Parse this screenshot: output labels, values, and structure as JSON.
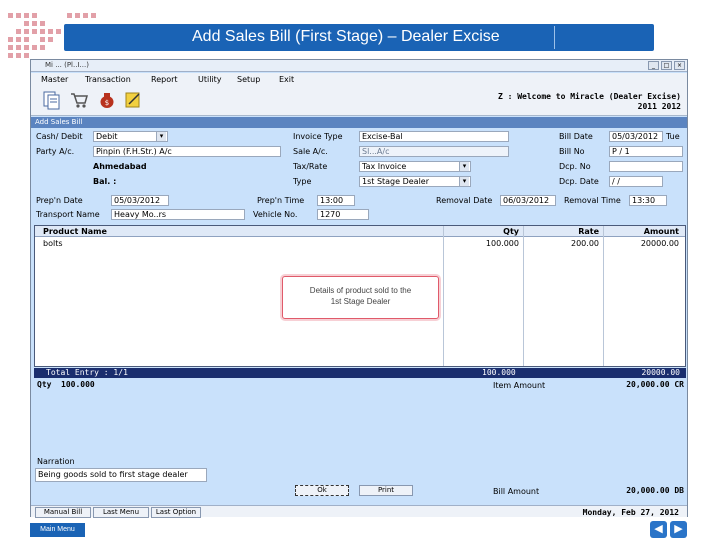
{
  "slide": {
    "title": "Add Sales Bill (First Stage) – Dealer Excise",
    "main_menu_label": "Main Menu",
    "prev_icon": "left-arrow-icon",
    "next_icon": "right-arrow-icon",
    "accent": "#1a63b5"
  },
  "window": {
    "title": "Mi ... (Pl..I...)",
    "menu": [
      "Master",
      "Transaction",
      "Report",
      "Utility",
      "Setup",
      "Exit"
    ],
    "welcome": "Z : Welcome to Miracle (Dealer Excise)",
    "year": "2011 2012",
    "subform_title": "Add Sales Bill"
  },
  "form": {
    "cash_debit_label": "Cash/ Debit",
    "cash_debit_value": "Debit",
    "party_label": "Party A/c.",
    "party_value": "Pinpin (F.H.Str.) A/c",
    "city": "Ahmedabad",
    "bal_label": "Bal. :",
    "invoice_type_label": "Invoice Type",
    "invoice_type_value": "Excise-Bal",
    "sale_ac_label": "Sale A/c.",
    "sale_ac_value": "Sl...A/c",
    "tax_rate_label": "Tax/Rate",
    "tax_rate_value": "Tax Invoice",
    "type_label": "Type",
    "type_value": "1st Stage Dealer",
    "bill_date_label": "Bill Date",
    "bill_date_value": "05/03/2012",
    "bill_date_suffix": "Tue",
    "bill_no_label": "Bill No",
    "bill_no_value": "P / 1",
    "dcp_no_label": "Dcp. No",
    "dcp_no_value": "",
    "dcp_date_label": "Dcp. Date",
    "dcp_date_value": "/ /",
    "prep_date_label": "Prep'n Date",
    "prep_date_value": "05/03/2012",
    "prep_time_label": "Prep'n Time",
    "prep_time_value": "13:00",
    "removal_date_label": "Removal Date",
    "removal_date_value": "06/03/2012",
    "removal_time_label": "Removal Time",
    "removal_time_value": "13:30",
    "transport_label": "Transport Name",
    "transport_value": "Heavy Mo..rs",
    "vehicle_label": "Vehicle No.",
    "vehicle_value": "1270"
  },
  "grid": {
    "headers": {
      "product": "Product Name",
      "qty": "Qty",
      "rate": "Rate",
      "amount": "Amount"
    },
    "rows": [
      {
        "product": "bolts",
        "qty": "100.000",
        "rate": "200.00",
        "amount": "20000.00"
      }
    ],
    "callout_line1": "Details of product sold to the",
    "callout_line2": "1st Stage Dealer",
    "total_entry": "Total Entry : 1/1",
    "total_qty": "100.000",
    "total_amount": "20000.00"
  },
  "summary": {
    "qty_label": "Qty",
    "qty_value": "100.000",
    "item_amount_label": "Item Amount",
    "item_amount_value": "20,000.00 CR",
    "narration_label": "Narration",
    "narration_value": "Being goods sold to first stage dealer",
    "ok_label": "Ok",
    "print_label": "Print",
    "bill_amount_label": "Bill Amount",
    "bill_amount_value": "20,000.00 DB"
  },
  "status": {
    "buttons": [
      "Manual Bill",
      "Last Menu",
      "Last Option"
    ],
    "date": "Monday, Feb 27, 2012"
  }
}
